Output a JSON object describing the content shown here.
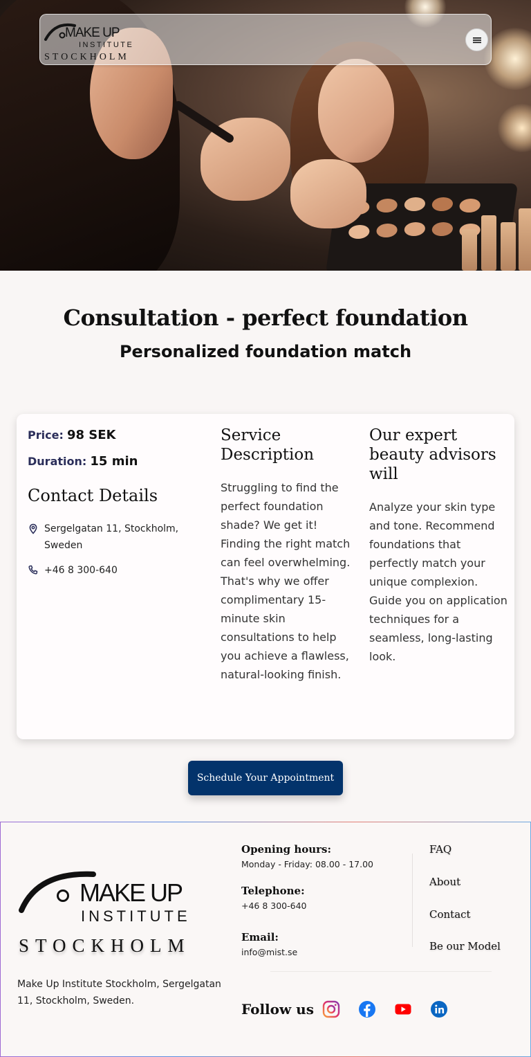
{
  "header": {
    "logo": {
      "make_up": "MAKE UP",
      "institute": "INSTITUTE",
      "city": "STOCKHOLM"
    },
    "menu_icon": "hamburger-menu-icon"
  },
  "hero": {
    "image": "makeup-artist-applying-foundation-photo"
  },
  "page": {
    "title": "Consultation - perfect foundation",
    "subtitle": "Personalized foundation match"
  },
  "service": {
    "price_label": "Price:",
    "price_value": "98 SEK",
    "duration_label": "Duration:",
    "duration_value": "15 min",
    "contact_heading": "Contact Details",
    "address": "Sergelgatan 11, Stockholm, Sweden",
    "phone": "+46 8 300-640",
    "description_heading": "Service Description",
    "description": "Struggling to find the perfect foundation shade? We get it! Finding the right match can feel overwhelming. That's why we offer complimentary 15-minute skin consultations to help you achieve a flawless, natural-looking finish.",
    "advisors_heading": "Our expert beauty advisors will",
    "advisors_text": "Analyze your skin type and tone. Recommend foundations that perfectly match your unique complexion. Guide you on application techniques for a seamless, long-lasting look."
  },
  "cta": {
    "label": "Schedule Your Appointment"
  },
  "footer": {
    "logo": {
      "make_up": "MAKE UP",
      "institute": "INSTITUTE",
      "city": "STOCKHOLM"
    },
    "address": "Make Up Institute Stockholm, Sergelgatan 11, Stockholm, Sweden.",
    "hours_label": "Opening hours:",
    "hours_value": "Monday - Friday: 08.00  - 17.00",
    "telephone_label": "Telephone:",
    "telephone_value": "+46 8 300-640",
    "email_label": "Email:",
    "email_value": "info@mist.se",
    "links": [
      "FAQ",
      "About",
      "Contact",
      "Be our Model"
    ],
    "follow_label": "Follow us",
    "socials": [
      "instagram-icon",
      "facebook-icon",
      "youtube-icon",
      "linkedin-icon"
    ]
  },
  "colors": {
    "primary": "#03336b",
    "label": "#2b2e5a",
    "background": "#f9f6f5",
    "card": "#fffcfd"
  }
}
